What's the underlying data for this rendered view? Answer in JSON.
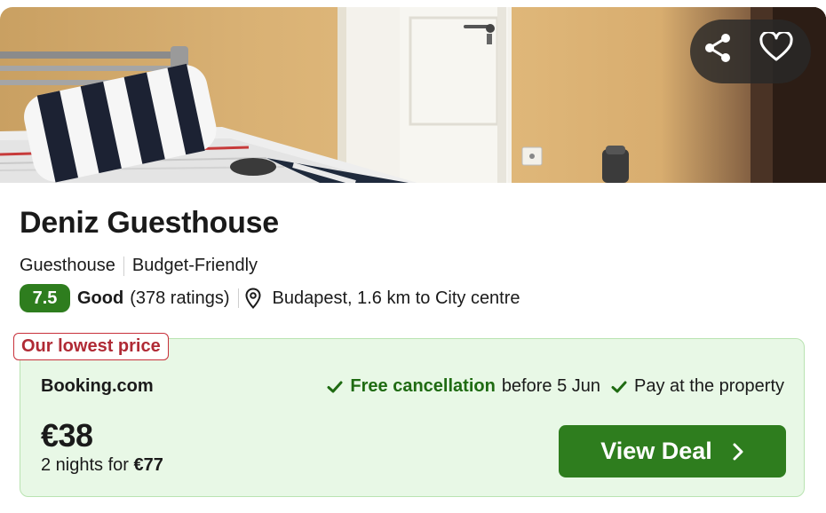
{
  "photo": {
    "alt_icon": "room-photo"
  },
  "actions": {
    "share_icon": "share-icon",
    "favorite_icon": "heart-icon"
  },
  "hotel": {
    "name": "Deniz Guesthouse",
    "tags": [
      "Guesthouse",
      "Budget-Friendly"
    ],
    "score": "7.5",
    "rating_word": "Good",
    "rating_count": "(378 ratings)",
    "location": "Budapest, 1.6 km to City centre"
  },
  "deal": {
    "badge": "Our lowest price",
    "provider": "Booking.com",
    "perk1_strong": "Free cancellation",
    "perk1_rest": "before 5 Jun",
    "perk2": "Pay at the property",
    "price": "€38",
    "nights_label": "2 nights for",
    "total": "€77",
    "cta": "View Deal"
  },
  "colors": {
    "accent_green": "#2e7d1e",
    "deal_bg": "#e8f8e6",
    "badge_red": "#b02a35"
  }
}
